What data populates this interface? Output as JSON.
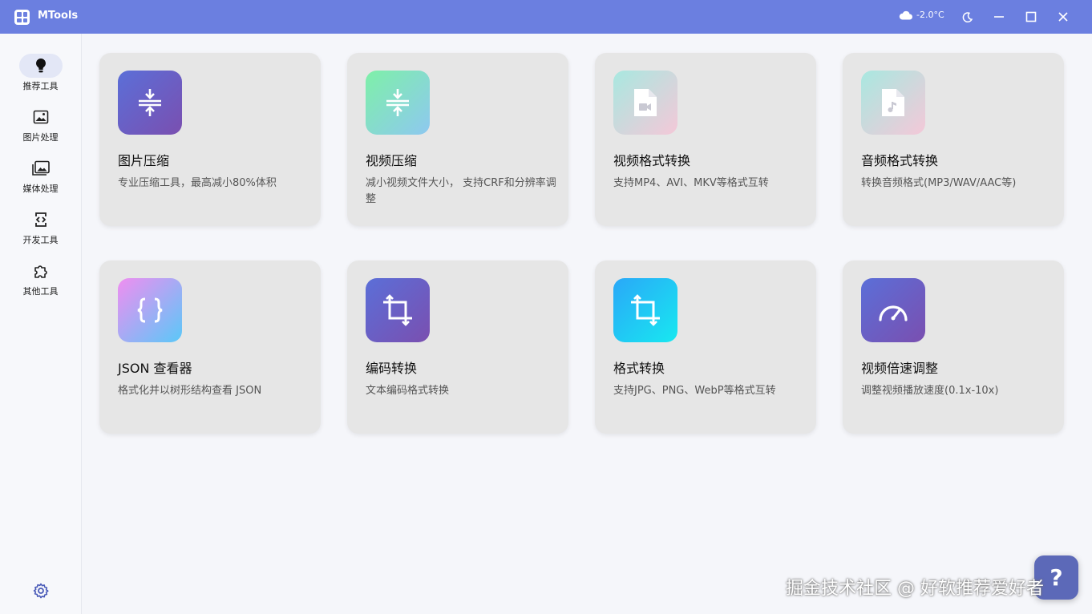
{
  "app": {
    "title": "MTools"
  },
  "weather": {
    "temp": "-2.0°C",
    "icon": "cloud-icon"
  },
  "window_controls": {
    "theme": "moon-icon",
    "minimize": "minimize-icon",
    "maximize": "maximize-icon",
    "close": "close-icon"
  },
  "sidebar": {
    "items": [
      {
        "label": "推荐工具",
        "icon": "lightbulb-icon",
        "active": true
      },
      {
        "label": "图片处理",
        "icon": "image-icon",
        "active": false
      },
      {
        "label": "媒体处理",
        "icon": "media-icon",
        "active": false
      },
      {
        "label": "开发工具",
        "icon": "code-icon",
        "active": false
      },
      {
        "label": "其他工具",
        "icon": "puzzle-icon",
        "active": false
      }
    ],
    "settings_icon": "gear-icon"
  },
  "cards": [
    {
      "title": "图片压缩",
      "desc": "专业压缩工具，最高减小80%体积",
      "icon": "compress-icon"
    },
    {
      "title": "视频压缩",
      "desc": "减小视频文件大小， 支持CRF和分辨率调整",
      "icon": "compress-icon"
    },
    {
      "title": "视频格式转换",
      "desc": "支持MP4、AVI、MKV等格式互转",
      "icon": "video-file-icon"
    },
    {
      "title": "音频格式转换",
      "desc": "转换音频格式(MP3/WAV/AAC等)",
      "icon": "audio-file-icon"
    },
    {
      "title": "JSON 查看器",
      "desc": "格式化并以树形结构查看 JSON",
      "icon": "braces-icon"
    },
    {
      "title": "编码转换",
      "desc": "文本编码格式转换",
      "icon": "crop-icon"
    },
    {
      "title": "格式转换",
      "desc": "支持JPG、PNG、WebP等格式互转",
      "icon": "crop-icon"
    },
    {
      "title": "视频倍速调整",
      "desc": "调整视频播放速度(0.1x-10x)",
      "icon": "speedometer-icon"
    }
  ],
  "help": {
    "label": "?"
  },
  "watermark": "掘金技术社区 @ 好软推荐爱好者"
}
